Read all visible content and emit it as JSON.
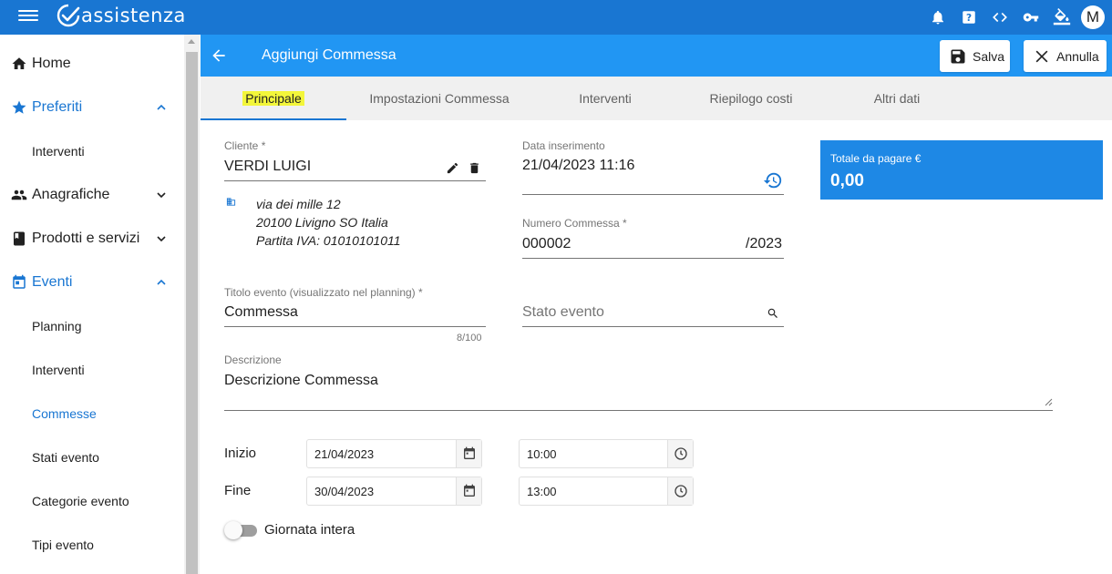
{
  "app": {
    "name": "assistenza",
    "avatar_letter": "M"
  },
  "topbar_icons": [
    "bell-icon",
    "help-icon",
    "code-icon",
    "key-icon",
    "paint-bucket-icon"
  ],
  "sidebar": {
    "home": "Home",
    "preferiti": "Preferiti",
    "preferiti_items": [
      "Interventi"
    ],
    "anagrafiche": "Anagrafiche",
    "prodotti": "Prodotti e servizi",
    "eventi": "Eventi",
    "eventi_items": [
      "Planning",
      "Interventi",
      "Commesse",
      "Stati evento",
      "Categorie evento",
      "Tipi evento"
    ]
  },
  "header": {
    "title": "Aggiungi Commessa",
    "save_label": "Salva",
    "cancel_label": "Annulla"
  },
  "tabs": [
    {
      "label": "Principale",
      "active": true
    },
    {
      "label": "Impostazioni Commessa"
    },
    {
      "label": "Interventi"
    },
    {
      "label": "Riepilogo costi"
    },
    {
      "label": "Altri dati"
    }
  ],
  "form": {
    "cliente_label": "Cliente *",
    "cliente_value": "VERDI LUIGI",
    "address_line1": "via dei mille 12",
    "address_line2": "20100 Livigno SO Italia",
    "address_line3": "Partita IVA: 01010101011",
    "data_label": "Data inserimento",
    "data_value": "21/04/2023 11:16",
    "numero_label": "Numero Commessa *",
    "numero_value": "000002",
    "numero_suffix": "/2023",
    "titolo_label": "Titolo evento (visualizzato nel planning) *",
    "titolo_value": "Commessa",
    "titolo_counter": "8/100",
    "stato_placeholder": "Stato evento",
    "descrizione_label": "Descrizione",
    "descrizione_value": "Descrizione Commessa",
    "inizio_label": "Inizio",
    "inizio_date": "21/04/2023",
    "inizio_time": "10:00",
    "fine_label": "Fine",
    "fine_date": "30/04/2023",
    "fine_time": "13:00",
    "giornata_label": "Giornata intera",
    "giornata_value": false
  },
  "totale": {
    "label": "Totale da pagare €",
    "value": "0,00"
  },
  "colors": {
    "appbar": "#1976d2",
    "mainbar": "#2196f3",
    "accent": "#1976d2",
    "total_box": "#1e88e5",
    "highlight": "#f3f63a"
  }
}
